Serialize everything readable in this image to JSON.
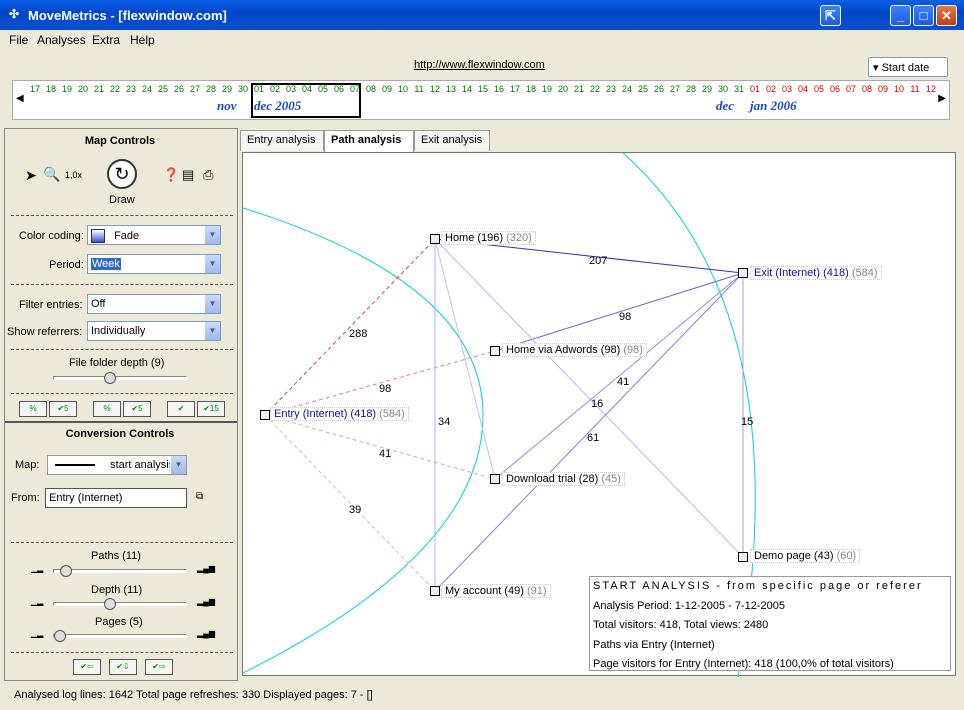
{
  "window": {
    "title": "MoveMetrics - [flexwindow.com]"
  },
  "menu": [
    "File",
    "Analyses",
    "Extra",
    "Help"
  ],
  "url": "http://www.flexwindow.com",
  "start_date_label": "Start date",
  "timeline": {
    "days": [
      "17",
      "18",
      "19",
      "20",
      "21",
      "22",
      "23",
      "24",
      "25",
      "26",
      "27",
      "28",
      "29",
      "30",
      "01",
      "02",
      "03",
      "04",
      "05",
      "06",
      "07",
      "08",
      "09",
      "10",
      "11",
      "12",
      "13",
      "14",
      "15",
      "16",
      "17",
      "18",
      "19",
      "20",
      "21",
      "22",
      "23",
      "24",
      "25",
      "26",
      "27",
      "28",
      "29",
      "30",
      "31",
      "01",
      "02",
      "03",
      "04",
      "05",
      "06",
      "07",
      "08",
      "09",
      "10",
      "11",
      "12"
    ],
    "months": {
      "nov": "nov",
      "dec": "dec 2005",
      "dec2": "dec",
      "jan": "jan 2006"
    }
  },
  "map_controls": {
    "title": "Map Controls",
    "zoom": "1,0x",
    "draw_label": "Draw",
    "color_coding_label": "Color coding:",
    "color_coding_value": "Fade",
    "period_label": "Period:",
    "period_value": "Week",
    "filter_entries_label": "Filter entries:",
    "filter_entries_value": "Off",
    "show_referrers_label": "Show referrers:",
    "show_referrers_value": "Individually",
    "folder_depth_label": "File folder depth (9)",
    "filter_buttons": [
      "%",
      "5",
      "%",
      "5",
      "",
      "15"
    ]
  },
  "conversion_controls": {
    "title": "Conversion Controls",
    "map_label": "Map:",
    "map_value": "start analysis",
    "from_label": "From:",
    "from_value": "Entry (Internet)",
    "paths_label": "Paths (11)",
    "depth_label": "Depth (11)",
    "pages_label": "Pages (5)"
  },
  "tabs": [
    "Entry analysis",
    "Path analysis",
    "Exit analysis"
  ],
  "active_tab": "Path analysis",
  "graph": {
    "nodes": [
      {
        "id": "home",
        "label": "Home (196)",
        "extra": "(320)"
      },
      {
        "id": "exit",
        "label": "Exit (Internet) (418)",
        "extra": "(584)"
      },
      {
        "id": "adwords",
        "label": "Home via Adwords (98)",
        "extra": "(98)"
      },
      {
        "id": "entry",
        "label": "Entry (Internet) (418)",
        "extra": "(584)"
      },
      {
        "id": "download",
        "label": "Download trial (28)",
        "extra": "(45)"
      },
      {
        "id": "demo",
        "label": "Demo page (43)",
        "extra": "(60)"
      },
      {
        "id": "account",
        "label": "My account (49)",
        "extra": "(91)"
      }
    ],
    "edge_labels": [
      "207",
      "288",
      "98",
      "98",
      "41",
      "34",
      "16",
      "61",
      "41",
      "15",
      "39"
    ]
  },
  "info": {
    "title": "START ANALYSIS - from specific page or referer",
    "period": "Analysis Period: 1-12-2005 - 7-12-2005",
    "totals": "Total visitors: 418, Total views: 2480",
    "paths": "Paths via Entry (Internet)",
    "page_visitors": "Page visitors for Entry (Internet): 418 (100,0% of total visitors)"
  },
  "status": "Analysed log lines: 1642  Total page refreshes: 330  Displayed pages: 7  -  []"
}
